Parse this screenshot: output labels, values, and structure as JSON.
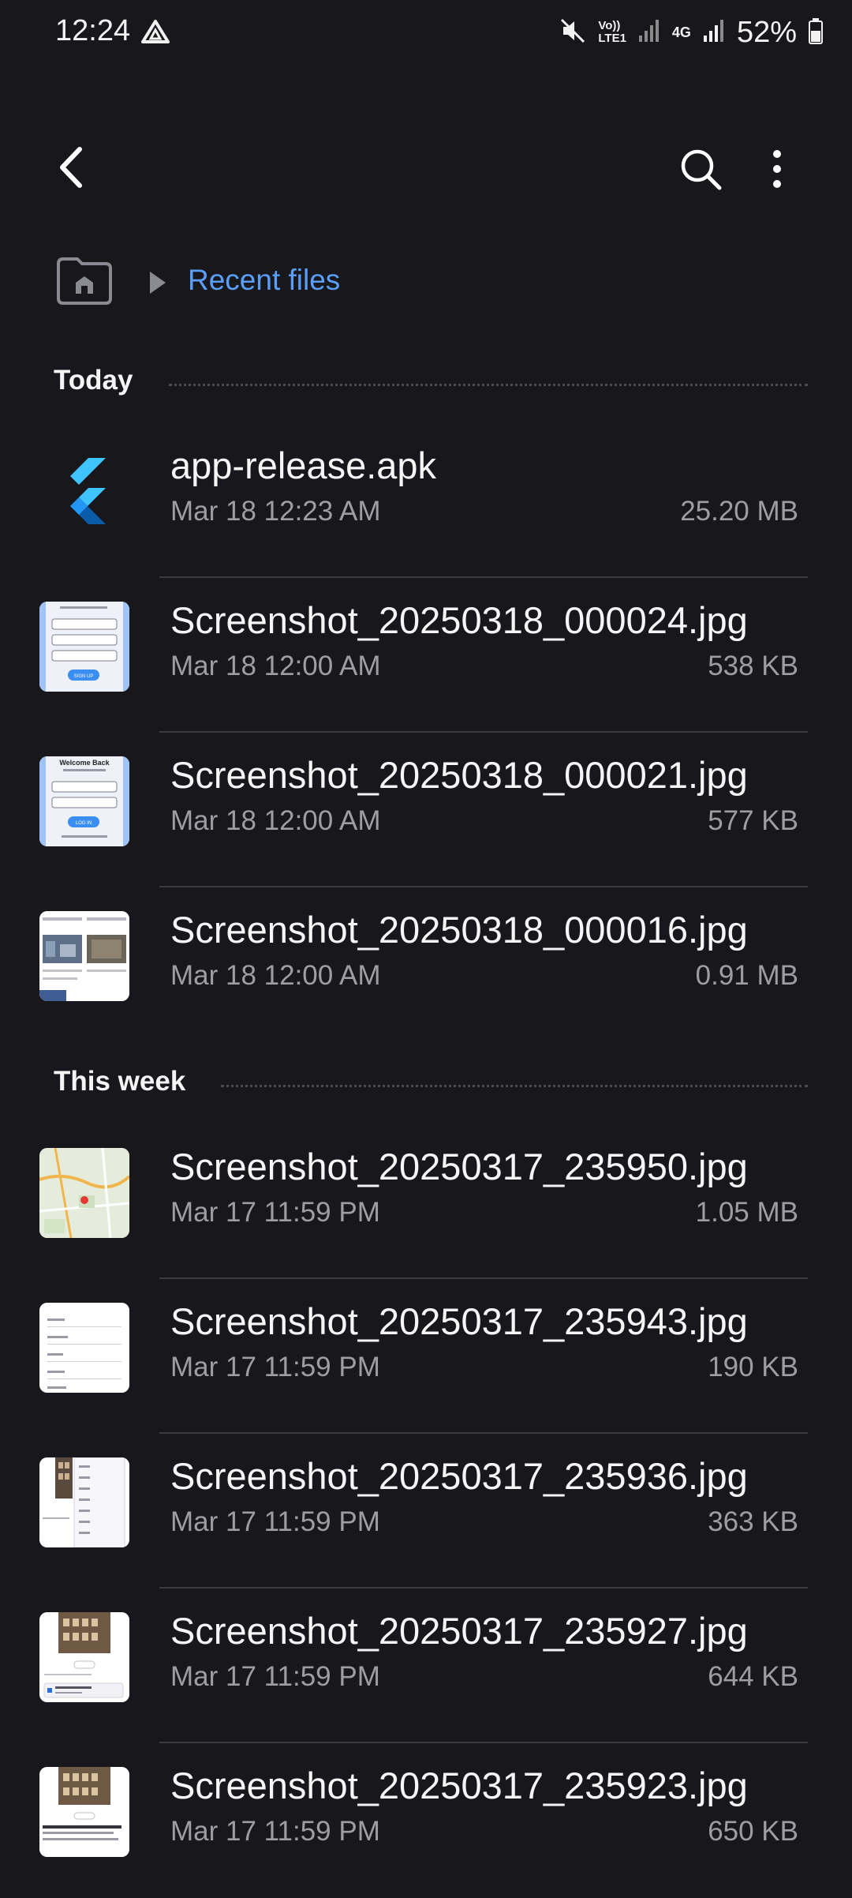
{
  "status_bar": {
    "time": "12:24",
    "network_label_top": "Vo))",
    "network_label_bottom": "LTE1",
    "network_4g": "4G",
    "battery": "52%"
  },
  "breadcrumb": {
    "label": "Recent files"
  },
  "sections": [
    {
      "title": "Today",
      "files": [
        {
          "name": "app-release.apk",
          "date": "Mar 18 12:23 AM",
          "size": "25.20 MB",
          "thumb": "flutter-logo"
        },
        {
          "name": "Screenshot_20250318_000024.jpg",
          "date": "Mar 18 12:00 AM",
          "size": "538 KB",
          "thumb": "signup-form"
        },
        {
          "name": "Screenshot_20250318_000021.jpg",
          "date": "Mar 18 12:00 AM",
          "size": "577 KB",
          "thumb": "login-form"
        },
        {
          "name": "Screenshot_20250318_000016.jpg",
          "date": "Mar 18 12:00 AM",
          "size": "0.91 MB",
          "thumb": "gallery"
        }
      ]
    },
    {
      "title": "This week",
      "files": [
        {
          "name": "Screenshot_20250317_235950.jpg",
          "date": "Mar 17 11:59 PM",
          "size": "1.05 MB",
          "thumb": "map"
        },
        {
          "name": "Screenshot_20250317_235943.jpg",
          "date": "Mar 17 11:59 PM",
          "size": "190 KB",
          "thumb": "list"
        },
        {
          "name": "Screenshot_20250317_235936.jpg",
          "date": "Mar 17 11:59 PM",
          "size": "363 KB",
          "thumb": "time-picker"
        },
        {
          "name": "Screenshot_20250317_235927.jpg",
          "date": "Mar 17 11:59 PM",
          "size": "644 KB",
          "thumb": "building-card"
        },
        {
          "name": "Screenshot_20250317_235923.jpg",
          "date": "Mar 17 11:59 PM",
          "size": "650 KB",
          "thumb": "building-article"
        }
      ]
    }
  ],
  "thumb_text": {
    "login_title": "Welcome Back",
    "login_button": "LOG IN",
    "signup_button": "SIGN UP"
  },
  "colors": {
    "background": "#18181c",
    "accent": "#5a9ef8",
    "secondary_text": "#9d9da4",
    "divider": "#3b3b42"
  },
  "icons": [
    "drive-icon",
    "mute-icon",
    "signal-icon",
    "battery-icon",
    "back-icon",
    "search-icon",
    "more-vert-icon",
    "home-folder-icon",
    "chevron-right-icon"
  ]
}
